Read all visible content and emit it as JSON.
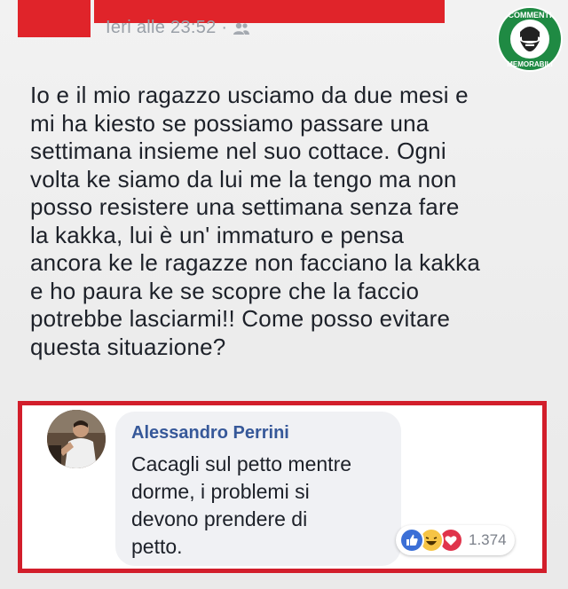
{
  "post": {
    "timestamp": "Ieri alle 23:52 · ",
    "privacy_icon": "friends-icon",
    "lines": [
      "Io e il mio ragazzo usciamo da due mesi e",
      "mi ha kiesto se possiamo passare una",
      "settimana insieme nel suo cottace. Ogni",
      "volta ke siamo da lui me la tengo ma non",
      "posso resistere una settimana senza fare",
      "la kakka, lui è un' immaturo e pensa",
      "ancora ke le ragazze non facciano la kakka",
      "e ho paura ke se scopre che la faccio",
      "potrebbe lasciarmi!! Come posso evitare",
      "questa situazione?"
    ]
  },
  "watermark": {
    "top_text": "COMMENTI",
    "bottom_text": "MEMORABILI",
    "icon": "bearded-face-icon",
    "color": "#1f8a43"
  },
  "comment": {
    "author": "Alessandro Perrini",
    "avatar_icon": "person-avatar-icon",
    "lines": [
      "Cacagli sul petto mentre",
      "dorme, i problemi si",
      "devono prendere di",
      "petto."
    ],
    "reactions": {
      "icons": [
        "like-icon",
        "haha-icon",
        "love-icon"
      ],
      "count": "1.374"
    }
  },
  "colors": {
    "redaction": "#e0242a",
    "highlight_frame": "#d21e2b",
    "author_link": "#365899"
  }
}
